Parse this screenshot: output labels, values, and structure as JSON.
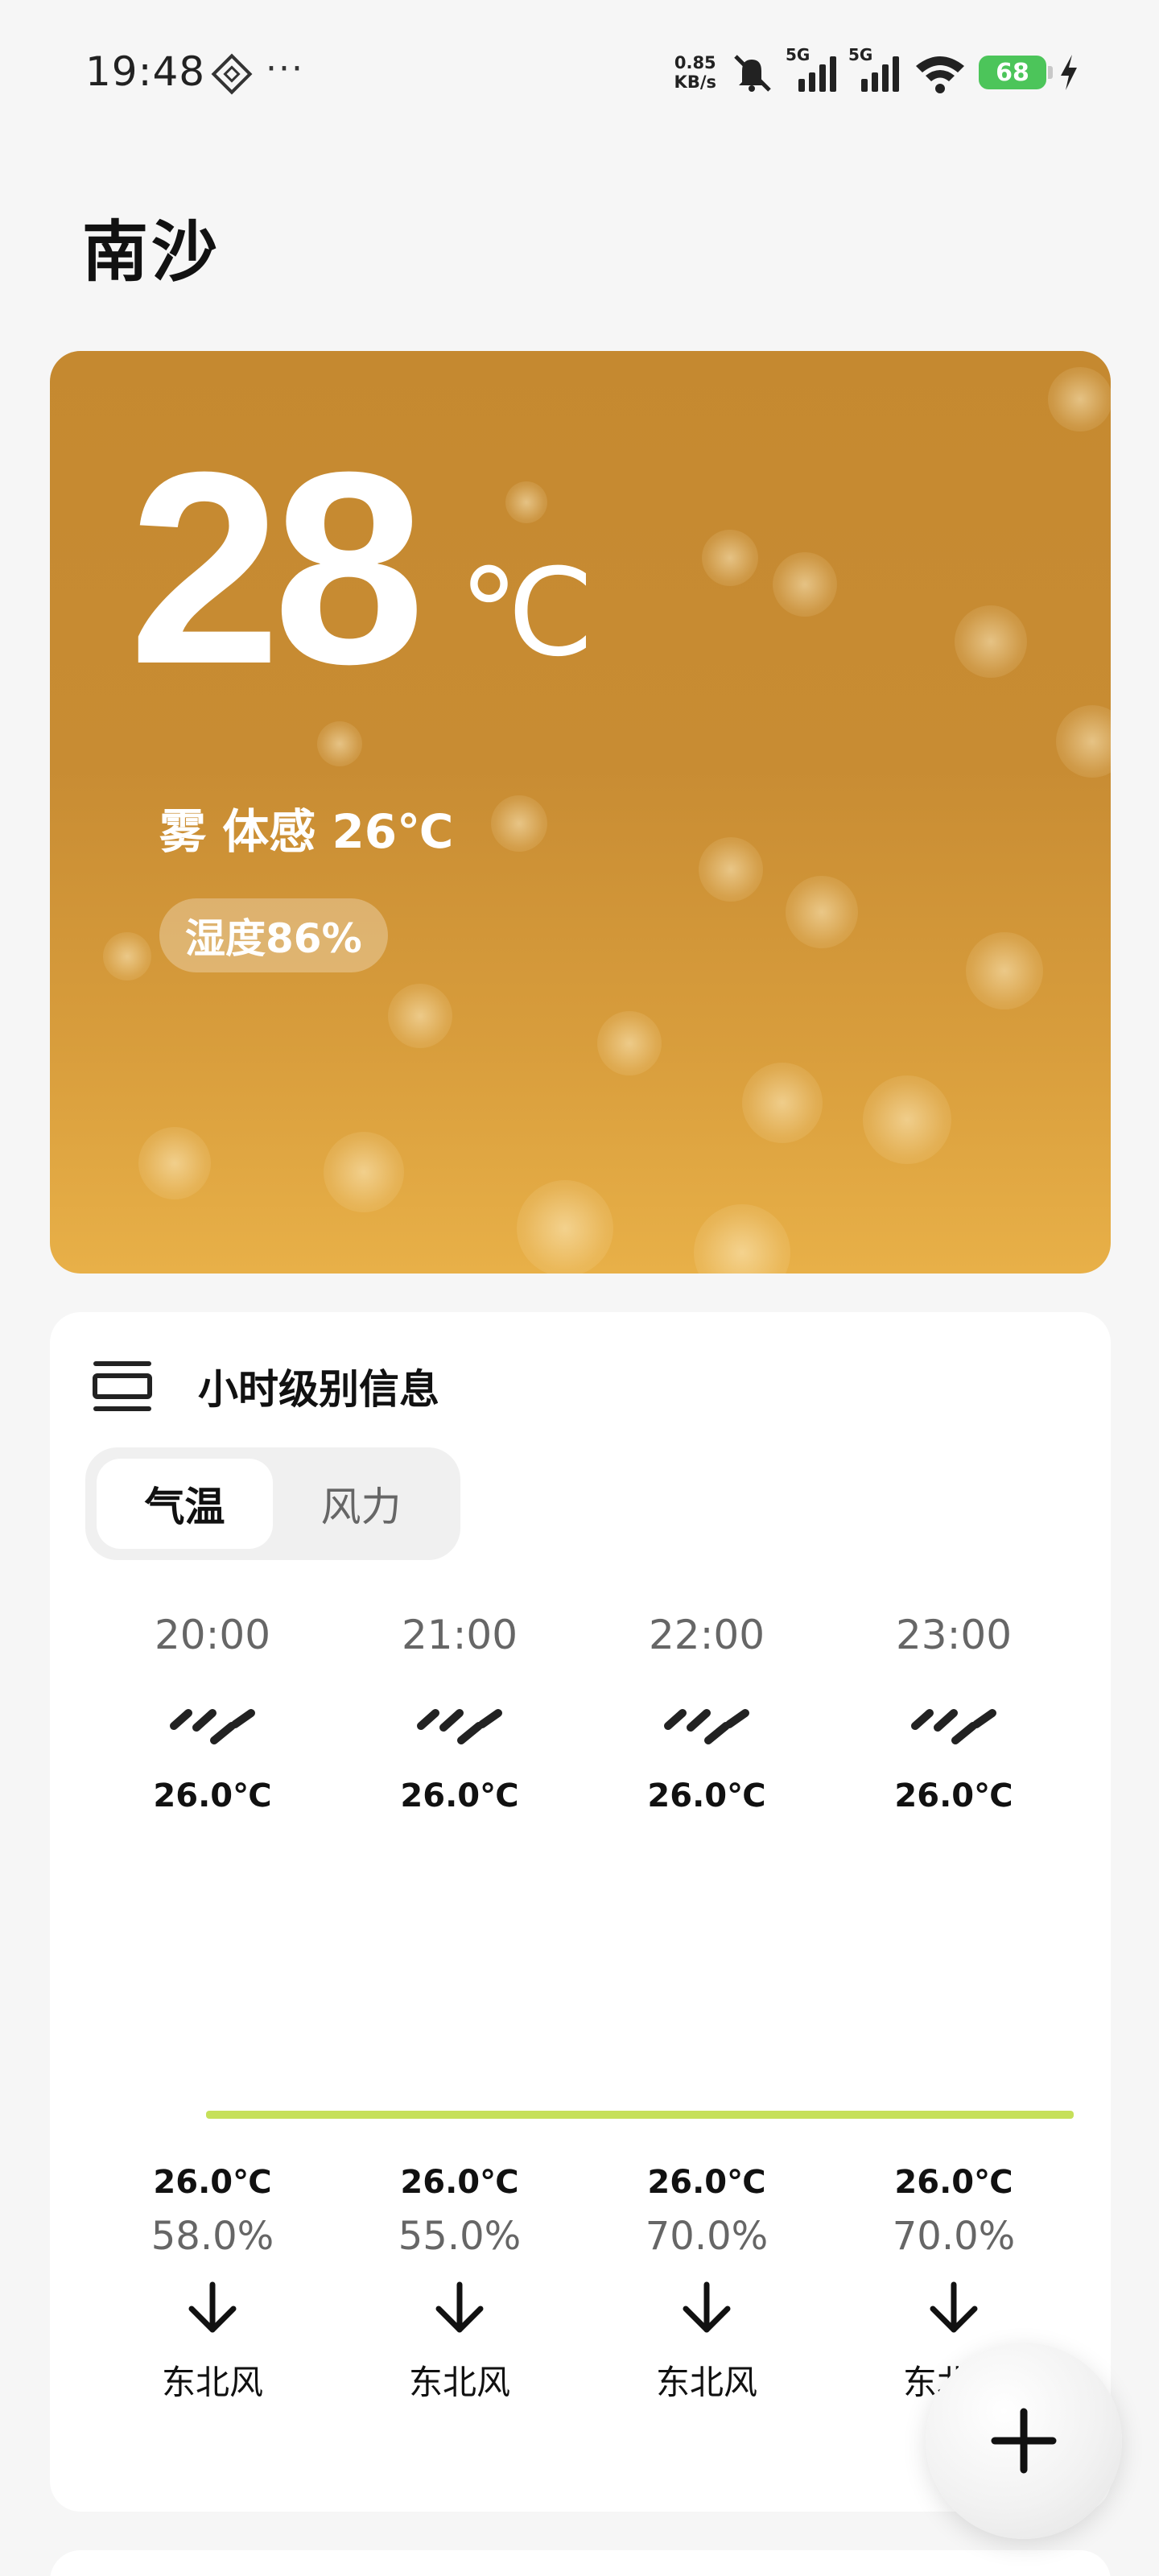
{
  "status_bar": {
    "time": "19:48",
    "more": "···",
    "net_speed_value": "0.85",
    "net_speed_unit": "KB/s",
    "sim1_label": "5G",
    "sim2_label": "5G",
    "battery": "68",
    "icons": [
      "app-notification-icon",
      "mute-icon",
      "signal-icon",
      "signal-icon",
      "wifi-icon",
      "battery-icon",
      "charging-icon"
    ]
  },
  "city": "南沙",
  "current": {
    "temperature": "28",
    "unit": "℃",
    "condition_line": "雾 体感 26℃",
    "humidity": "湿度86%"
  },
  "hourly": {
    "title": "小时级别信息",
    "tabs": [
      {
        "label": "气温",
        "active": true
      },
      {
        "label": "风力",
        "active": false
      }
    ],
    "hours": [
      {
        "time": "20:00",
        "icon": "fog-icon",
        "temp_top": "26.0℃",
        "temp_bottom": "26.0℃",
        "humidity": "58.0%",
        "wind_dir": "东北风"
      },
      {
        "time": "21:00",
        "icon": "fog-icon",
        "temp_top": "26.0℃",
        "temp_bottom": "26.0℃",
        "humidity": "55.0%",
        "wind_dir": "东北风"
      },
      {
        "time": "22:00",
        "icon": "fog-icon",
        "temp_top": "26.0℃",
        "temp_bottom": "26.0℃",
        "humidity": "70.0%",
        "wind_dir": "东北风"
      },
      {
        "time": "23:00",
        "icon": "fog-icon",
        "temp_top": "26.0℃",
        "temp_bottom": "26.0℃",
        "humidity": "70.0%",
        "wind_dir": "东北风"
      }
    ],
    "temp_line_color": "#c6e05a"
  },
  "colors": {
    "card_top": "#c58930",
    "card_bottom": "#e8b048",
    "battery": "#4cc55a"
  }
}
